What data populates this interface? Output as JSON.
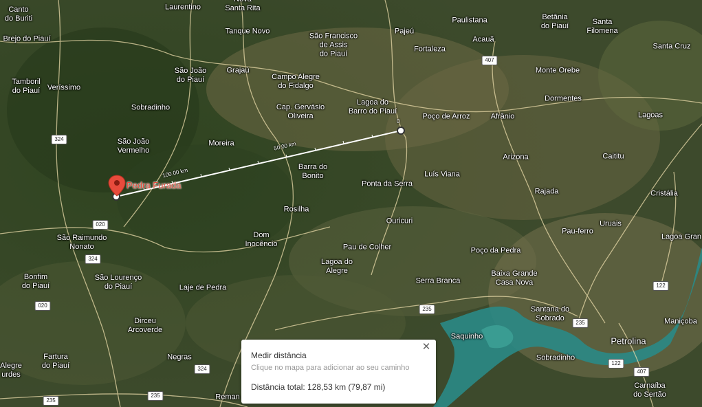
{
  "map": {
    "places": [
      {
        "name": "Canto\ndo Buriti"
      },
      {
        "name": "Laurentino"
      },
      {
        "name": "Nova\nSanta Rita"
      },
      {
        "name": "Brejo do Piauí"
      },
      {
        "name": "Tanque Novo"
      },
      {
        "name": "São Francisco\nde Assis\ndo Piauí"
      },
      {
        "name": "Pajeú"
      },
      {
        "name": "Paulistana"
      },
      {
        "name": "Acauã"
      },
      {
        "name": "Betânia\ndo Piauí"
      },
      {
        "name": "Santa\nFilomena"
      },
      {
        "name": "Fortaleza"
      },
      {
        "name": "Santa Cruz"
      },
      {
        "name": "São João\ndo Piauí"
      },
      {
        "name": "Grajaú"
      },
      {
        "name": "Campo Alegre\ndo Fidalgo"
      },
      {
        "name": "Monte Orebe"
      },
      {
        "name": "Tamboril\ndo Piauí"
      },
      {
        "name": "Veríssimo"
      },
      {
        "name": "Dormentes"
      },
      {
        "name": "Sobradinho"
      },
      {
        "name": "Cap. Gervásio\nOliveira"
      },
      {
        "name": "Lagoa do\nBarro do Piauí"
      },
      {
        "name": "Poço de Arroz"
      },
      {
        "name": "Afrânio"
      },
      {
        "name": "Lagoas"
      },
      {
        "name": "São João\nVermelho"
      },
      {
        "name": "Moreira"
      },
      {
        "name": "Arizona"
      },
      {
        "name": "Caititu"
      },
      {
        "name": "Barra do\nBonito"
      },
      {
        "name": "Luís Viana"
      },
      {
        "name": "Ponta da Serra"
      },
      {
        "name": "Rajada"
      },
      {
        "name": "Cristália"
      },
      {
        "name": "Rosilha"
      },
      {
        "name": "Ouricuri"
      },
      {
        "name": "Pau-ferro"
      },
      {
        "name": "Uruais"
      },
      {
        "name": "São Raimundo\nNonato"
      },
      {
        "name": "Dom\nInocêncio"
      },
      {
        "name": "Lagoa Gran"
      },
      {
        "name": "Pau de Colher"
      },
      {
        "name": "Poço da Pedra"
      },
      {
        "name": "Lagoa do\nAlegre"
      },
      {
        "name": "Bonfim\ndo Piauí"
      },
      {
        "name": "São Lourenço\ndo Piauí"
      },
      {
        "name": "Baixa Grande\nCasa Nova"
      },
      {
        "name": "Serra Branca"
      },
      {
        "name": "Laje de Pedra"
      },
      {
        "name": "Santana do\nSobrado"
      },
      {
        "name": "Dirceu\nArcoverde"
      },
      {
        "name": "Maniçoba"
      },
      {
        "name": "Saquinho"
      },
      {
        "name": "Petrolina"
      },
      {
        "name": "Fartura\ndo Piauí"
      },
      {
        "name": "Negras"
      },
      {
        "name": "Sobradinho"
      },
      {
        "name": "Alegre\nurdes"
      },
      {
        "name": "Carnaíba\ndo Sertão"
      },
      {
        "name": "Reman"
      }
    ],
    "shields": [
      "324",
      "407",
      "020",
      "324",
      "020",
      "122",
      "235",
      "235",
      "122",
      "407",
      "324",
      "235",
      "235"
    ],
    "measure": {
      "start_label": "0",
      "mid_label": "50.00 km",
      "end_label": "100.00 km"
    },
    "pin": {
      "label": "Pedra Furada",
      "color": "#e84b3c"
    }
  },
  "panel": {
    "title": "Medir distância",
    "hint": "Clique no mapa para adicionar ao seu caminho",
    "total": "Distância total: 128,53 km (79,87 mi)",
    "close": "✕"
  },
  "colors": {
    "water": "#2a8a86",
    "road": "#e8d9a8",
    "line": "#ffffff"
  }
}
